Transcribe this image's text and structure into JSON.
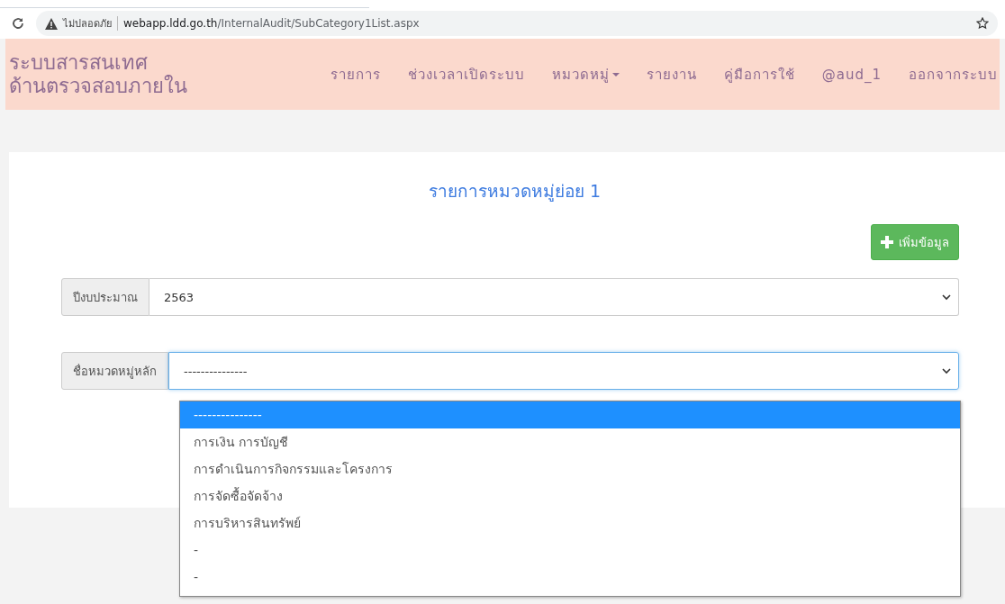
{
  "browser": {
    "security_label": "ไม่ปลอดภัย",
    "url_host": "webapp.ldd.go.th",
    "url_path": "/InternalAudit/SubCategory1List.aspx"
  },
  "navbar": {
    "brand": [
      "ระบบสารสนเทศ",
      "ด้านตรวจสอบภายใน"
    ],
    "items": [
      {
        "label": "รายการ",
        "caret": false
      },
      {
        "label": "ช่วงเวลาเปิดระบบ",
        "caret": false
      },
      {
        "label": "หมวดหมู่",
        "caret": true
      },
      {
        "label": "รายงาน",
        "caret": false
      },
      {
        "label": "คู่มือการใช้",
        "caret": false
      },
      {
        "label": "@aud_1",
        "caret": false
      },
      {
        "label": "ออกจากระบบ",
        "caret": false
      }
    ]
  },
  "page": {
    "title": "รายการหมวดหมู่ย่อย 1",
    "add_button": "เพิ่มข้อมูล"
  },
  "filters": [
    {
      "label": "ปีงบประมาณ",
      "value": "2563",
      "focused": false
    },
    {
      "label": "ชื่อหมวดหมู่หลัก",
      "value": "---------------",
      "focused": true
    }
  ],
  "dropdown": {
    "options": [
      {
        "label": "---------------",
        "selected": true
      },
      {
        "label": "การเงิน การบัญชี",
        "selected": false
      },
      {
        "label": "การดำเนินการกิจกรรมและโครงการ",
        "selected": false
      },
      {
        "label": "การจัดซื้อจัดจ้าง",
        "selected": false
      },
      {
        "label": "การบริหารสินทรัพย์",
        "selected": false
      },
      {
        "label": "-",
        "selected": false
      },
      {
        "label": "-",
        "selected": false
      }
    ]
  }
}
